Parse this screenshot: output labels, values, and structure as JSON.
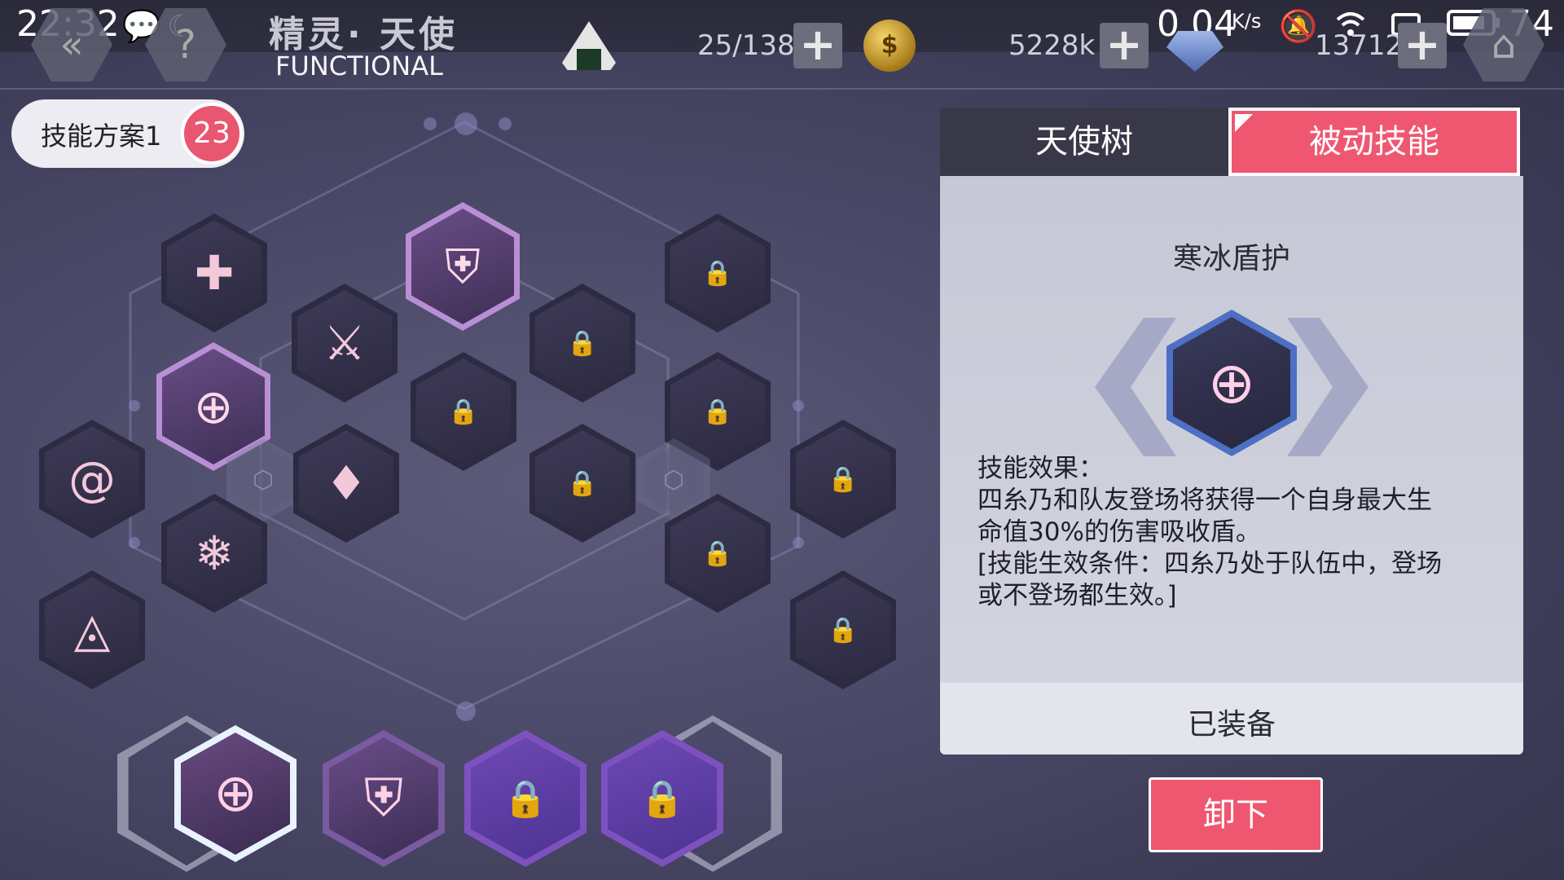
{
  "status_bar": {
    "time": "22:32",
    "network_speed": "0.04",
    "network_unit": "K/s",
    "battery": "74",
    "icons": [
      "chat-bubble-icon",
      "moon-icon",
      "mute-bell-icon",
      "wifi-icon",
      "screen-rotate-icon",
      "battery-icon"
    ]
  },
  "topbar": {
    "title_cn": "精灵· 天使",
    "title_en": "FUNCTIONAL",
    "stamina": "25/138",
    "gold": "5228k",
    "diamonds": "13712"
  },
  "skill_plan": {
    "label": "技能方案1",
    "points": "23"
  },
  "tree": {
    "locked_symbol": "🔒"
  },
  "tabs": {
    "tree": "天使树",
    "passive": "被动技能"
  },
  "detail": {
    "skill_name": "寒冰盾护",
    "effect_title": "技能效果：",
    "effect_line1": "四糸乃和队友登场将获得一个自身最大生",
    "effect_line2": "命值30%的伤害吸收盾。",
    "effect_line3": "[技能生效条件：四糸乃处于队伍中，登场",
    "effect_line4": "或不登场都生效。]",
    "status": "已装备"
  },
  "actions": {
    "unequip": "卸下"
  },
  "colors": {
    "accent_red": "#ef5770",
    "badge_red": "#e9566f",
    "panel_bg": "#c6c8d6"
  }
}
